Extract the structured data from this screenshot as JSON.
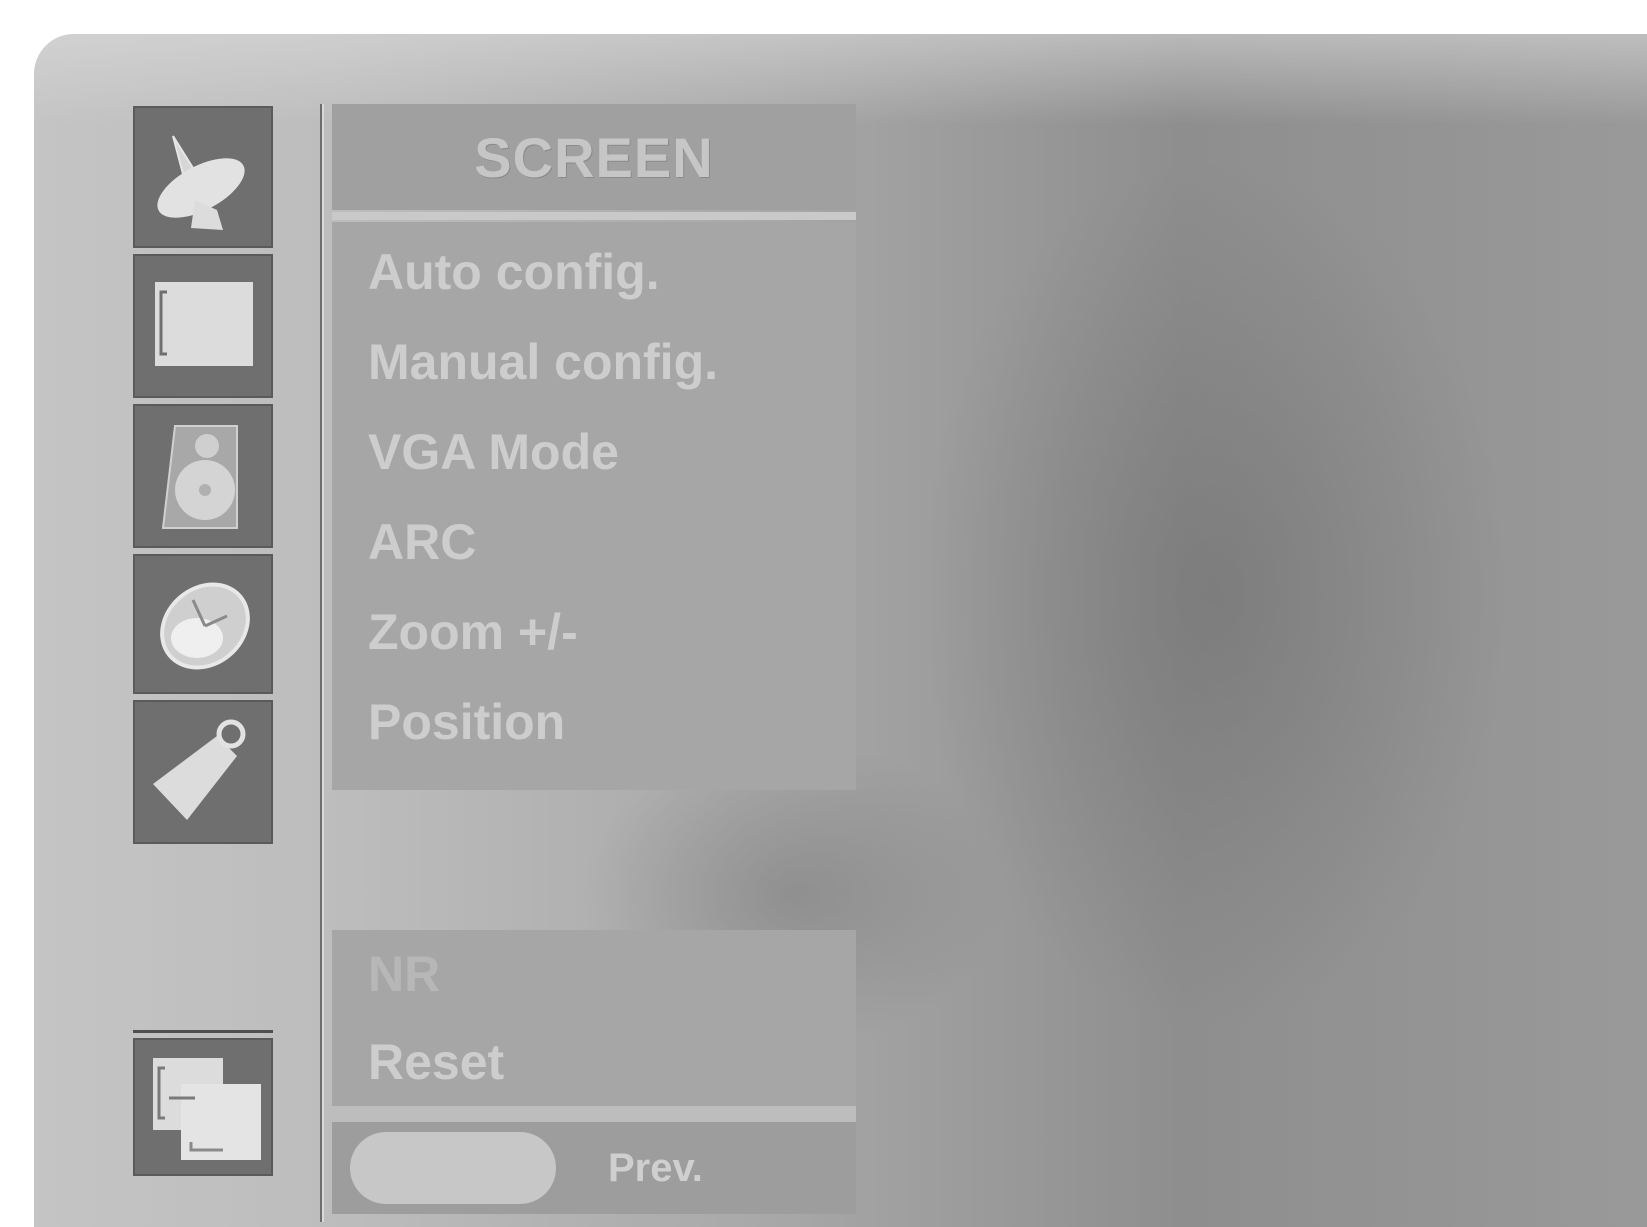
{
  "menu": {
    "title": "SCREEN",
    "items": [
      {
        "label": "Auto config."
      },
      {
        "label": "Manual config."
      },
      {
        "label": "VGA Mode"
      },
      {
        "label": "ARC"
      },
      {
        "label": "Zoom +/-"
      },
      {
        "label": "Position"
      }
    ],
    "lower_items": [
      {
        "label": "NR",
        "state": "disabled"
      },
      {
        "label": "Reset"
      }
    ]
  },
  "footer": {
    "prev_label": "Prev."
  },
  "sidebar": {
    "icons": [
      "satellite-dish-icon",
      "picture-icon",
      "speaker-icon",
      "clock-icon",
      "tag-icon"
    ],
    "bottom_icon": "screen-overlap-icon"
  }
}
